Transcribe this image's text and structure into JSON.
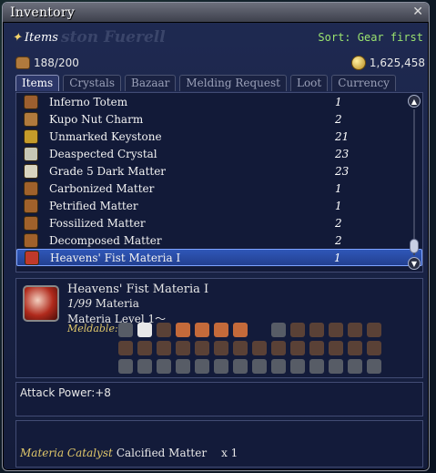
{
  "window": {
    "title": "Inventory",
    "close_glyph": "✕"
  },
  "header": {
    "label": "Items",
    "sort": "Sort: Gear first",
    "ghost_name": "ston Fuerell"
  },
  "counts": {
    "capacity": "188/200",
    "gil": "1,625,458"
  },
  "tabs": [
    "Items",
    "Crystals",
    "Bazaar",
    "Melding Request",
    "Loot",
    "Currency"
  ],
  "items": [
    {
      "name": "Inferno Totem",
      "qty": "1",
      "icon": "totem-icon",
      "color": "#9c5f2f"
    },
    {
      "name": "Kupo Nut Charm",
      "qty": "2",
      "icon": "charm-icon",
      "color": "#b07a3d"
    },
    {
      "name": "Unmarked Keystone",
      "qty": "21",
      "icon": "keystone-icon",
      "color": "#c59b2a"
    },
    {
      "name": "Deaspected Crystal",
      "qty": "23",
      "icon": "crystal-icon",
      "color": "#c7c7b5"
    },
    {
      "name": "Grade 5 Dark Matter",
      "qty": "23",
      "icon": "dark-matter-icon",
      "color": "#d9d4c0"
    },
    {
      "name": "Carbonized Matter",
      "qty": "1",
      "icon": "matter-icon",
      "color": "#a0612b"
    },
    {
      "name": "Petrified Matter",
      "qty": "1",
      "icon": "matter-icon",
      "color": "#a0612b"
    },
    {
      "name": "Fossilized Matter",
      "qty": "2",
      "icon": "matter-icon",
      "color": "#a0612b"
    },
    {
      "name": "Decomposed Matter",
      "qty": "2",
      "icon": "matter-icon",
      "color": "#a0612b"
    },
    {
      "name": "Heavens' Fist Materia I",
      "qty": "1",
      "icon": "materia-icon",
      "color": "#c0392b"
    }
  ],
  "detail": {
    "name": "Heavens' Fist Materia I",
    "stack": "1/99",
    "type": "Materia",
    "level": "Materia Level 1～",
    "meldable_label": "Meldable:",
    "stat": "Attack Power:+8",
    "catalyst_label": "Materia Catalyst",
    "catalyst_item": "Calcified Matter",
    "catalyst_qty": "x 1"
  }
}
